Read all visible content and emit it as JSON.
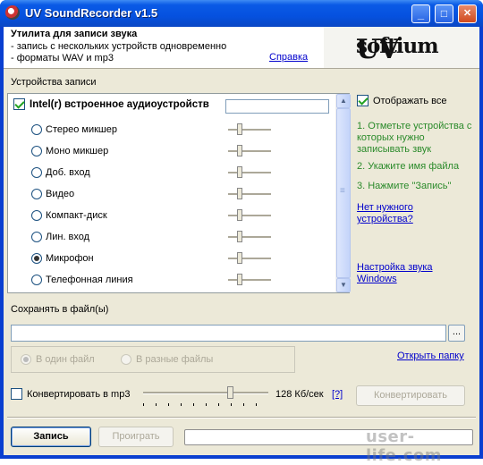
{
  "window": {
    "title": "UV SoundRecorder v1.5",
    "buttons": {
      "minimize": "_",
      "maximize": "□",
      "close": "✕"
    }
  },
  "header": {
    "title": "Утилита для записи звука",
    "lines": [
      "- запись с нескольких устройств одновременно",
      "- форматы WAV и mp3"
    ],
    "help_link": "Справка",
    "logo_big": "UV",
    "logo_small": "softium"
  },
  "devices": {
    "group_label": "Устройства записи",
    "main_device": {
      "label": "Intel(r) встроенное аудиоустройств",
      "checked": true,
      "name_value": ""
    },
    "inputs": [
      {
        "label": "Стерео микшер",
        "selected": false
      },
      {
        "label": "Моно микшер",
        "selected": false
      },
      {
        "label": "Доб. вход",
        "selected": false
      },
      {
        "label": "Видео",
        "selected": false
      },
      {
        "label": "Компакт-диск",
        "selected": false
      },
      {
        "label": "Лин. вход",
        "selected": false
      },
      {
        "label": "Микрофон",
        "selected": true
      },
      {
        "label": "Телефонная линия",
        "selected": false
      }
    ]
  },
  "side": {
    "show_all": {
      "label": "Отображать все",
      "checked": true
    },
    "steps": [
      "1. Отметьте устройства с которых нужно записывать звук",
      "2. Укажите имя файла",
      "3. Нажмите \"Запись\""
    ],
    "missing_device_link": "Нет нужного устройства?",
    "sound_settings_link": "Настройка звука Windows"
  },
  "save": {
    "label": "Сохранять в файл(ы)",
    "path_value": "",
    "browse": "...",
    "modes": [
      {
        "label": "В один файл",
        "selected": true
      },
      {
        "label": "В разные файлы",
        "selected": false
      }
    ],
    "open_folder_link": "Открыть папку"
  },
  "convert": {
    "label": "Конвертировать в mp3",
    "checked": false,
    "bitrate": "128 Кб/сек",
    "help": "[?]",
    "button": "Конвертировать"
  },
  "actions": {
    "record": "Запись",
    "play": "Проиграть"
  },
  "watermark": "user-life.com"
}
